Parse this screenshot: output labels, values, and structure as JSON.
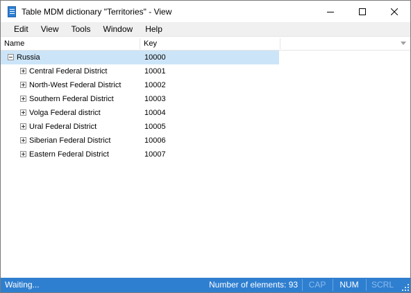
{
  "window": {
    "title": "Table MDM dictionary \"Territories\" - View"
  },
  "menu": {
    "items": [
      "Edit",
      "View",
      "Tools",
      "Window",
      "Help"
    ]
  },
  "grid": {
    "columns": [
      "Name",
      "Key"
    ],
    "rows": [
      {
        "name": "Russia",
        "key": "10000",
        "level": 0,
        "expanded": true,
        "selected": true
      },
      {
        "name": "Central Federal District",
        "key": "10001",
        "level": 1,
        "expanded": false,
        "selected": false
      },
      {
        "name": "North-West Federal District",
        "key": "10002",
        "level": 1,
        "expanded": false,
        "selected": false
      },
      {
        "name": "Southern Federal District",
        "key": "10003",
        "level": 1,
        "expanded": false,
        "selected": false
      },
      {
        "name": "Volga Federal district",
        "key": "10004",
        "level": 1,
        "expanded": false,
        "selected": false
      },
      {
        "name": "Ural Federal District",
        "key": "10005",
        "level": 1,
        "expanded": false,
        "selected": false
      },
      {
        "name": "Siberian Federal District",
        "key": "10006",
        "level": 1,
        "expanded": false,
        "selected": false
      },
      {
        "name": "Eastern Federal District",
        "key": "10007",
        "level": 1,
        "expanded": false,
        "selected": false
      }
    ]
  },
  "status": {
    "message": "Waiting...",
    "count_label": "Number of elements: 93",
    "cap": "CAP",
    "num": "NUM",
    "scrl": "SCRL",
    "cap_active": false,
    "num_active": true,
    "scrl_active": false
  },
  "colors": {
    "statusbar": "#2f7fd0",
    "selection": "#cce4f7",
    "menubar": "#f0f0f0"
  },
  "icons": [
    "table-dictionary-icon",
    "minimize-icon",
    "maximize-icon",
    "close-icon",
    "column-dropdown-icon",
    "expand-icon",
    "collapse-icon",
    "resize-grip-icon"
  ]
}
